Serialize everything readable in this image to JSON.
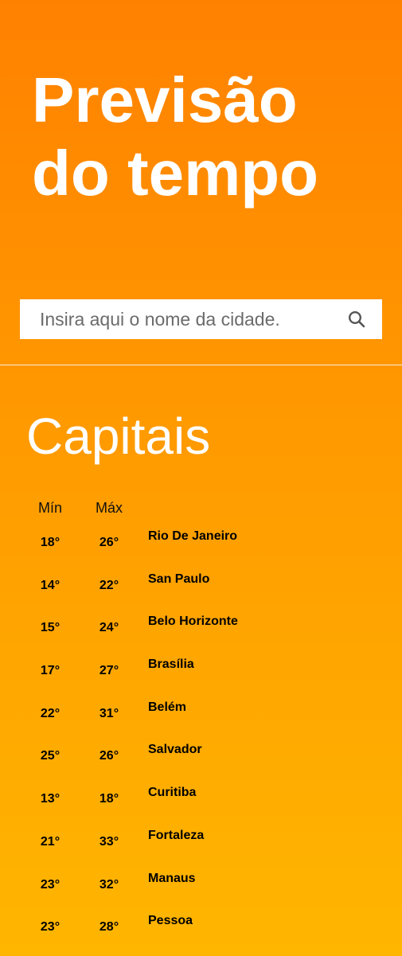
{
  "header": {
    "title_line1": "Previsão",
    "title_line2": "do tempo"
  },
  "search": {
    "placeholder": "Insira aqui o nome da cidade.",
    "icon": "search-icon"
  },
  "capitals": {
    "title": "Capitais",
    "col_min": "Mín",
    "col_max": "Máx",
    "rows": [
      {
        "min": "18°",
        "max": "26°",
        "city": "Rio De Janeiro"
      },
      {
        "min": "14°",
        "max": "22°",
        "city": "San Paulo"
      },
      {
        "min": "15°",
        "max": "24°",
        "city": "Belo Horizonte"
      },
      {
        "min": "17°",
        "max": "27°",
        "city": "Brasília"
      },
      {
        "min": "22°",
        "max": "31°",
        "city": "Belém"
      },
      {
        "min": "25°",
        "max": "26°",
        "city": "Salvador"
      },
      {
        "min": "13°",
        "max": "18°",
        "city": "Curitiba"
      },
      {
        "min": "21°",
        "max": "33°",
        "city": "Fortaleza"
      },
      {
        "min": "23°",
        "max": "32°",
        "city": "Manaus"
      },
      {
        "min": "23°",
        "max": "28°",
        "city": "Pessoa"
      }
    ]
  },
  "colors": {
    "gradient_top": "#ff8100",
    "gradient_bottom": "#ffb600",
    "title_text": "#ffffff",
    "table_text": "#000000"
  }
}
